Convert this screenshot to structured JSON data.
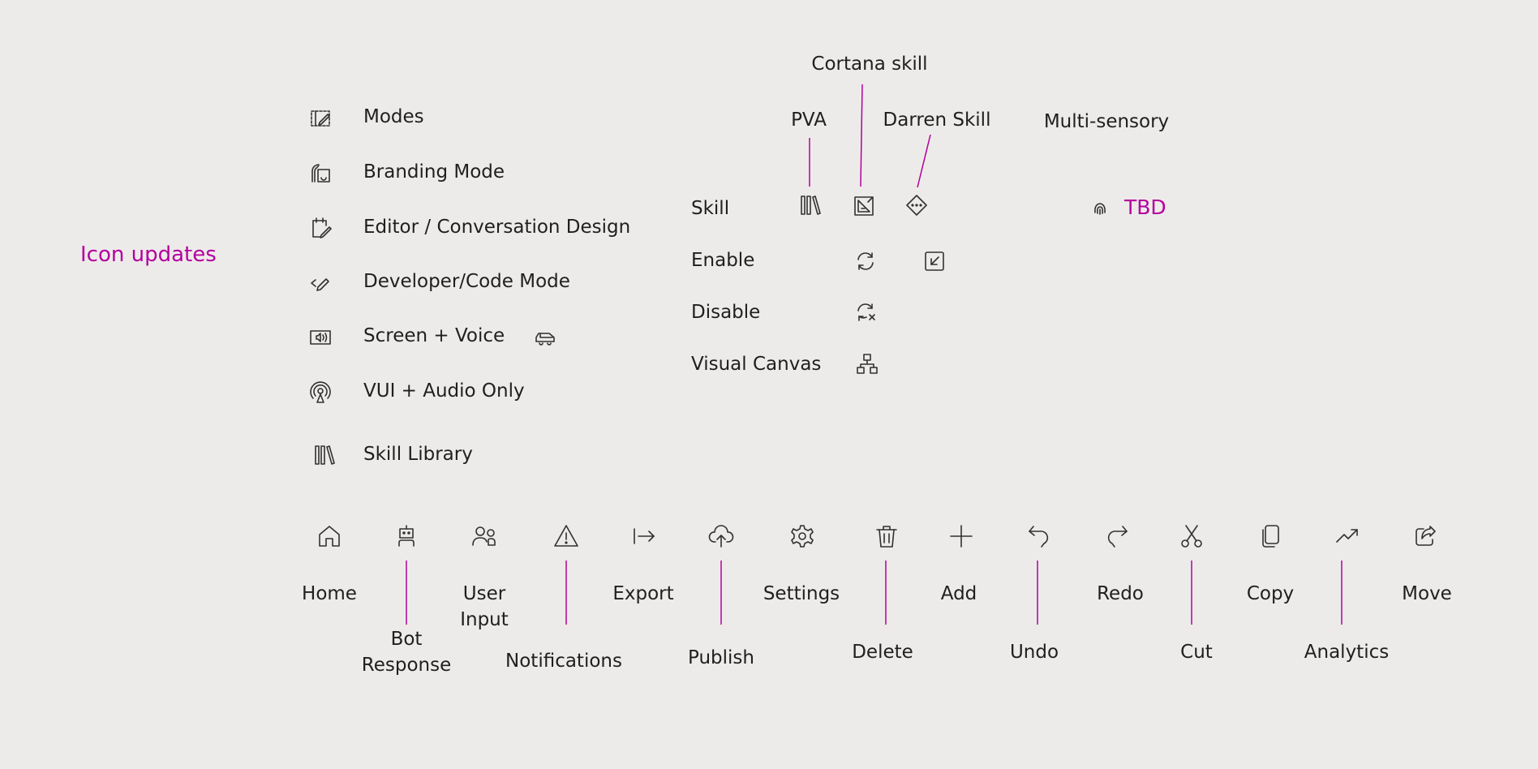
{
  "heading": "Icon updates",
  "modes": [
    {
      "icon": "modes-icon",
      "label": "Modes"
    },
    {
      "icon": "branding-icon",
      "label": "Branding Mode"
    },
    {
      "icon": "editor-icon",
      "label": "Editor / Conversation Design"
    },
    {
      "icon": "code-icon",
      "label": "Developer/Code Mode"
    },
    {
      "icon": "screen-voice-icon",
      "label": "Screen + Voice"
    },
    {
      "icon": "audio-icon",
      "label": "VUI + Audio Only"
    },
    {
      "icon": "library-icon",
      "label": "Skill Library"
    }
  ],
  "extra_icon": "vehicle-icon",
  "skills": {
    "top_labels": {
      "pva": "PVA",
      "cortana": "Cortana skill",
      "darren": "Darren Skill",
      "multi": "Multi-sensory"
    },
    "rows": [
      "Skill",
      "Enable",
      "Disable",
      "Visual Canvas"
    ],
    "tbd": "TBD",
    "accent_color": "#b4009e"
  },
  "toolbar": [
    {
      "icon": "home-icon",
      "label": "Home"
    },
    {
      "icon": "bot-icon",
      "label": "Bot Response"
    },
    {
      "icon": "user-input-icon",
      "label": "User Input"
    },
    {
      "icon": "warning-icon",
      "label": "Notifications"
    },
    {
      "icon": "export-icon",
      "label": "Export"
    },
    {
      "icon": "cloud-upload-icon",
      "label": "Publish"
    },
    {
      "icon": "gear-icon",
      "label": "Settings"
    },
    {
      "icon": "trash-icon",
      "label": "Delete"
    },
    {
      "icon": "plus-icon",
      "label": "Add"
    },
    {
      "icon": "undo-icon",
      "label": "Undo"
    },
    {
      "icon": "redo-icon",
      "label": "Redo"
    },
    {
      "icon": "scissors-icon",
      "label": "Cut"
    },
    {
      "icon": "copy-icon",
      "label": "Copy"
    },
    {
      "icon": "trend-icon",
      "label": "Analytics"
    },
    {
      "icon": "share-icon",
      "label": "Move"
    }
  ]
}
